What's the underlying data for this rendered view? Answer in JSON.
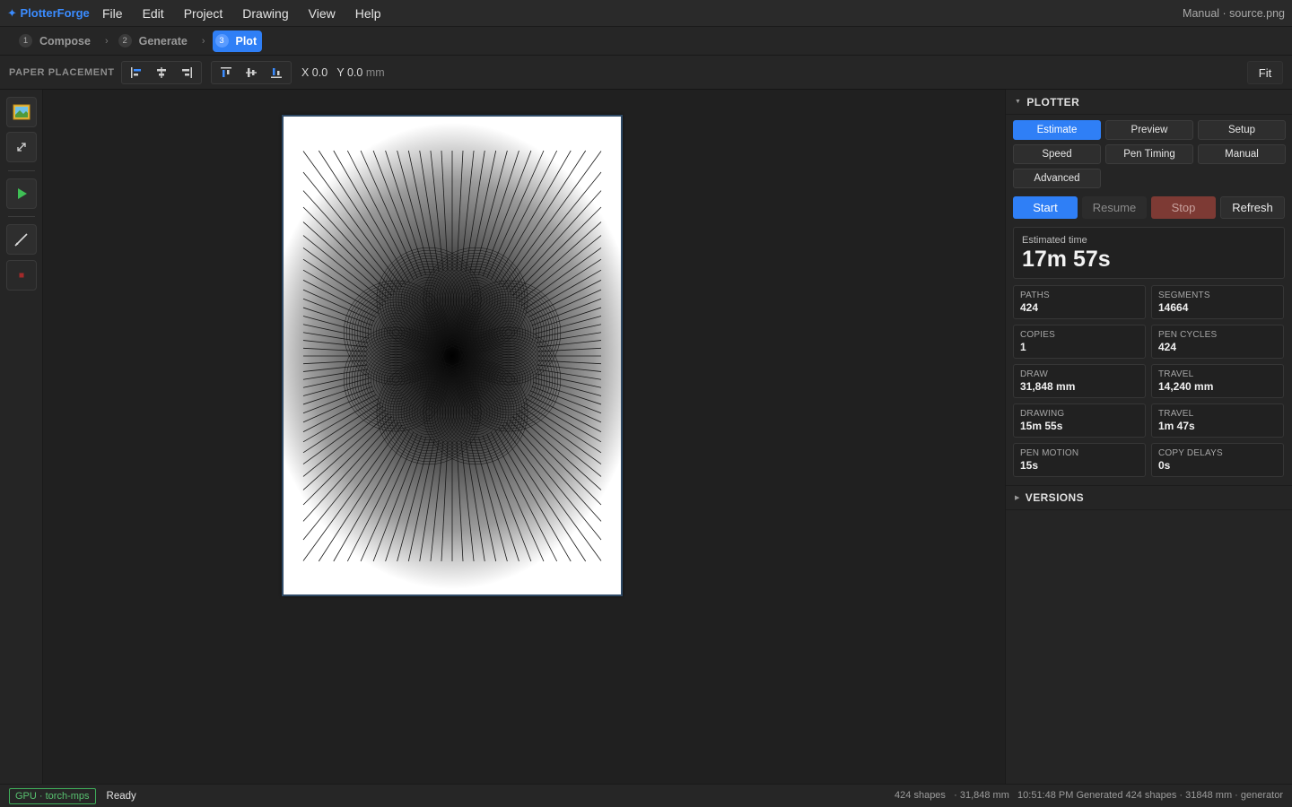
{
  "app": {
    "brand": "✦ PlotterForge",
    "window_title": "Manual · source.png",
    "menu": [
      "File",
      "Edit",
      "Project",
      "Drawing",
      "View",
      "Help"
    ]
  },
  "steps": [
    {
      "num": "1",
      "label": "Compose",
      "active": false
    },
    {
      "num": "2",
      "label": "Generate",
      "active": false
    },
    {
      "num": "3",
      "label": "Plot",
      "active": true
    }
  ],
  "toolbar": {
    "label": "PAPER PLACEMENT",
    "horizontal_align": [
      "align-left-icon",
      "align-center-h-icon",
      "align-right-icon"
    ],
    "vertical_align": [
      "align-top-icon",
      "align-middle-v-icon",
      "align-bottom-icon"
    ],
    "x_value": "X 0.0",
    "y_value": "Y 0.0",
    "unit": "mm",
    "fit_label": "Fit"
  },
  "rail": {
    "tools": [
      "image-icon",
      "resize-icon",
      "play-icon",
      "pen-icon",
      "stop-square-icon"
    ]
  },
  "plotter": {
    "section_title": "PLOTTER",
    "tabs": [
      {
        "label": "Estimate",
        "active": true
      },
      {
        "label": "Preview",
        "active": false
      },
      {
        "label": "Setup",
        "active": false
      },
      {
        "label": "Speed",
        "active": false
      },
      {
        "label": "Pen Timing",
        "active": false
      },
      {
        "label": "Manual",
        "active": false
      },
      {
        "label": "Advanced",
        "active": false
      }
    ],
    "controls": {
      "start": "Start",
      "resume": "Resume",
      "stop": "Stop",
      "refresh": "Refresh"
    },
    "estimate": {
      "label": "Estimated time",
      "value": "17m 57s"
    },
    "stats": [
      {
        "label": "PATHS",
        "value": "424"
      },
      {
        "label": "SEGMENTS",
        "value": "14664"
      },
      {
        "label": "COPIES",
        "value": "1"
      },
      {
        "label": "PEN CYCLES",
        "value": "424"
      },
      {
        "label": "DRAW",
        "value": "31,848 mm"
      },
      {
        "label": "TRAVEL",
        "value": "14,240 mm"
      },
      {
        "label": "DRAWING",
        "value": "15m 55s"
      },
      {
        "label": "TRAVEL",
        "value": "1m 47s"
      },
      {
        "label": "PEN MOTION",
        "value": "15s"
      },
      {
        "label": "COPY DELAYS",
        "value": "0s"
      }
    ]
  },
  "versions": {
    "section_title": "VERSIONS"
  },
  "status": {
    "gpu": "GPU · torch-mps",
    "ready": "Ready",
    "shapes": "424 shapes",
    "length": "· 31,848 mm",
    "log": "10:51:48 PM Generated 424 shapes · 31848 mm · generator"
  },
  "colors": {
    "accent": "#2f7ff6",
    "stop": "#7d3a34",
    "gpu": "#3fae5a"
  }
}
